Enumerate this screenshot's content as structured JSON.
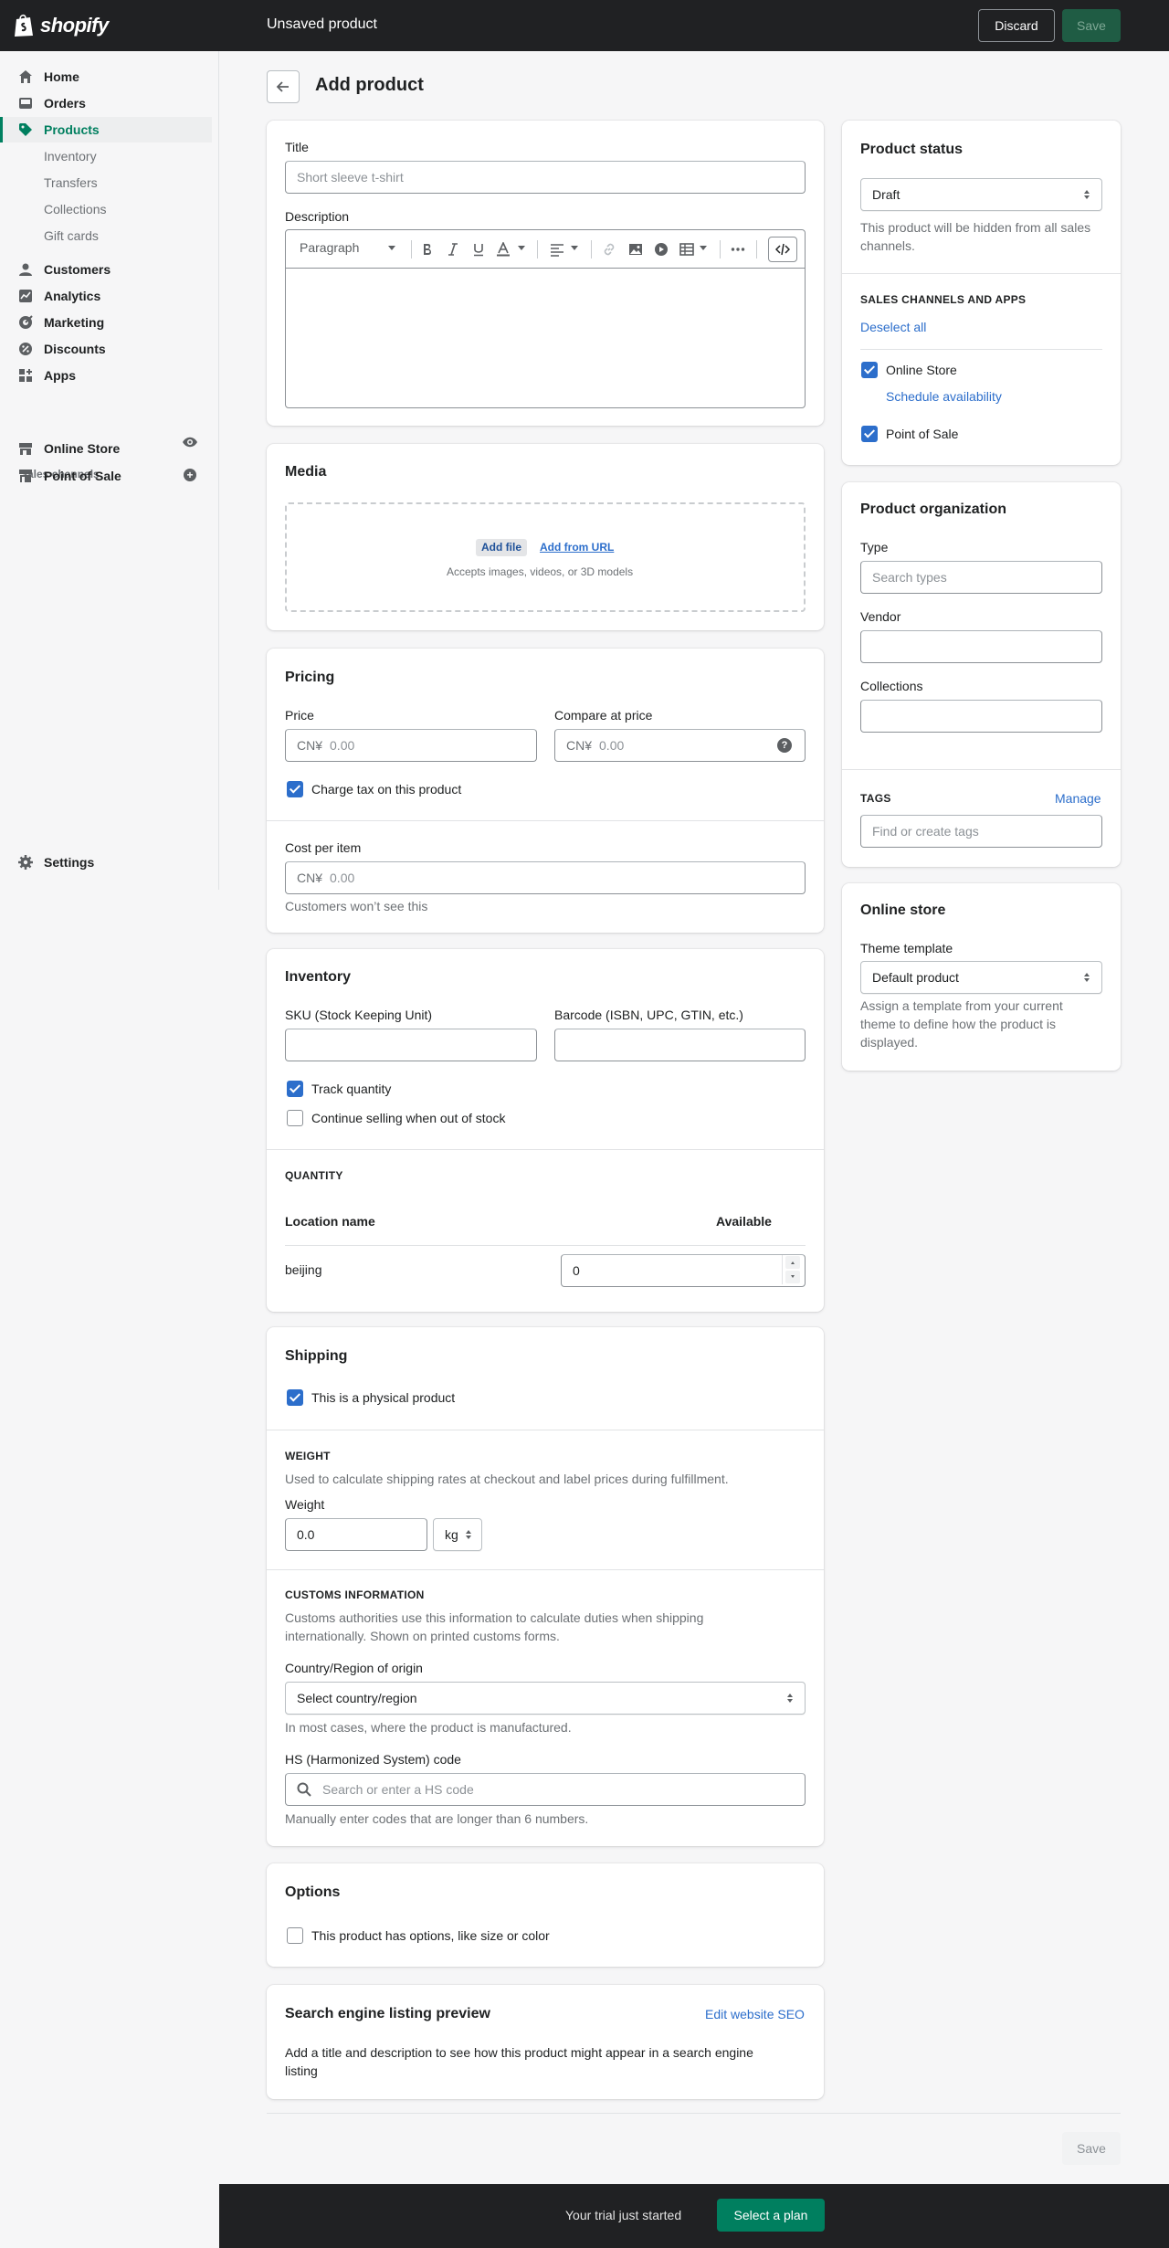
{
  "header": {
    "brand": "shopify",
    "title": "Unsaved product",
    "discard_label": "Discard",
    "save_label": "Save"
  },
  "sidebar": {
    "items": [
      {
        "label": "Home",
        "icon": "home-icon"
      },
      {
        "label": "Orders",
        "icon": "orders-icon"
      },
      {
        "label": "Products",
        "icon": "tag-icon",
        "active": true
      },
      {
        "label": "Customers",
        "icon": "customer-icon"
      },
      {
        "label": "Analytics",
        "icon": "analytics-icon"
      },
      {
        "label": "Marketing",
        "icon": "marketing-icon"
      },
      {
        "label": "Discounts",
        "icon": "discount-icon"
      },
      {
        "label": "Apps",
        "icon": "apps-icon"
      }
    ],
    "product_subitems": [
      "Inventory",
      "Transfers",
      "Collections",
      "Gift cards"
    ],
    "sales_channels_heading": "Sales channels",
    "channels": [
      {
        "label": "Online Store",
        "icon": "online-store-icon"
      },
      {
        "label": "Point of Sale",
        "icon": "pos-icon"
      }
    ],
    "settings_label": "Settings"
  },
  "page": {
    "title": "Add product"
  },
  "title_card": {
    "title_label": "Title",
    "title_placeholder": "Short sleeve t-shirt",
    "description_label": "Description",
    "paragraph_label": "Paragraph"
  },
  "media": {
    "heading": "Media",
    "add_file": "Add file",
    "add_from_url": "Add from URL",
    "accepts": "Accepts images, videos, or 3D models"
  },
  "pricing": {
    "heading": "Pricing",
    "price_label": "Price",
    "compare_label": "Compare at price",
    "currency": "CN¥",
    "price_placeholder": "0.00",
    "compare_placeholder": "0.00",
    "charge_tax_label": "Charge tax on this product",
    "charge_tax": true,
    "cost_label": "Cost per item",
    "cost_placeholder": "0.00",
    "cost_help": "Customers won’t see this"
  },
  "inventory": {
    "heading": "Inventory",
    "sku_label": "SKU (Stock Keeping Unit)",
    "barcode_label": "Barcode (ISBN, UPC, GTIN, etc.)",
    "track_label": "Track quantity",
    "track": true,
    "continue_label": "Continue selling when out of stock",
    "continue": false,
    "quantity_heading": "QUANTITY",
    "col_location": "Location name",
    "col_available": "Available",
    "location": "beijing",
    "available": "0"
  },
  "shipping": {
    "heading": "Shipping",
    "physical_label": "This is a physical product",
    "physical": true,
    "weight_heading": "WEIGHT",
    "weight_help": "Used to calculate shipping rates at checkout and label prices during fulfillment.",
    "weight_label": "Weight",
    "weight_value": "0.0",
    "weight_unit": "kg",
    "customs_heading": "CUSTOMS INFORMATION",
    "customs_help_1": "Customs authorities use this information to calculate duties when shipping",
    "customs_help_2": "internationally. Shown on printed customs forms.",
    "country_label": "Country/Region of origin",
    "country_value": "Select country/region",
    "country_help": "In most cases, where the product is manufactured.",
    "hs_label": "HS (Harmonized System) code",
    "hs_placeholder": "Search or enter a HS code",
    "hs_help": "Manually enter codes that are longer than 6 numbers."
  },
  "options": {
    "heading": "Options",
    "has_options_label": "This product has options, like size or color",
    "has_options": false
  },
  "seo": {
    "heading": "Search engine listing preview",
    "edit_link": "Edit website SEO",
    "help_1": "Add a title and description to see how this product might appear in a search engine",
    "help_2": "listing"
  },
  "status": {
    "heading": "Product status",
    "value": "Draft",
    "help_1": "This product will be hidden from all sales",
    "help_2": "channels.",
    "channels_heading": "SALES CHANNELS AND APPS",
    "deselect_all": "Deselect all",
    "online_store": "Online Store",
    "online_store_checked": true,
    "schedule": "Schedule availability",
    "pos": "Point of Sale",
    "pos_checked": true
  },
  "organization": {
    "heading": "Product organization",
    "type_label": "Type",
    "type_placeholder": "Search types",
    "vendor_label": "Vendor",
    "collections_label": "Collections",
    "tags_heading": "TAGS",
    "manage": "Manage",
    "tags_placeholder": "Find or create tags"
  },
  "online_store_card": {
    "heading": "Online store",
    "theme_label": "Theme template",
    "theme_value": "Default product",
    "help_1": "Assign a template from your current",
    "help_2": "theme to define how the product is",
    "help_3": "displayed."
  },
  "footer": {
    "save_label": "Save",
    "trial_text": "Your trial just started",
    "plan_button": "Select a plan"
  },
  "colors": {
    "accent": "#008060",
    "link": "#2c6ecb",
    "topbar": "#202123"
  }
}
